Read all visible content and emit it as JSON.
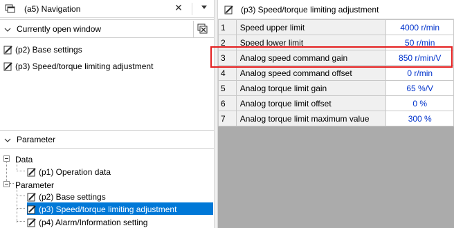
{
  "navigation": {
    "title": "(a5) Navigation",
    "close_glyph": "✕",
    "open_window_section": {
      "label": "Currently open window",
      "items": [
        {
          "label": "(p2) Base settings",
          "icon": "pencil-page-icon"
        },
        {
          "label": "(p3) Speed/torque limiting adjustment",
          "icon": "pencil-page-icon"
        }
      ]
    },
    "parameter_section": {
      "label": "Parameter",
      "tree": {
        "data_label": "Data",
        "data_children": [
          {
            "label": "(p1) Operation data"
          }
        ],
        "parameter_label": "Parameter",
        "parameter_children": [
          {
            "label": "(p2) Base settings",
            "selected": false
          },
          {
            "label": "(p3) Speed/torque limiting adjustment",
            "selected": true
          },
          {
            "label": "(p4) Alarm/Information setting",
            "selected": false
          }
        ]
      }
    }
  },
  "window": {
    "title": "(p3) Speed/torque limiting adjustment"
  },
  "table": {
    "rows": [
      {
        "no": "1",
        "name": "Speed upper limit",
        "value": "4000 r/min"
      },
      {
        "no": "2",
        "name": "Speed lower limit",
        "value": "50 r/min"
      },
      {
        "no": "3",
        "name": "Analog speed command gain",
        "value": "850 r/min/V"
      },
      {
        "no": "4",
        "name": "Analog speed command offset",
        "value": "0 r/min"
      },
      {
        "no": "5",
        "name": "Analog torque limit gain",
        "value": "65 %/V"
      },
      {
        "no": "6",
        "name": "Analog torque limit offset",
        "value": "0 %"
      },
      {
        "no": "7",
        "name": "Analog torque limit maximum value",
        "value": "300 %"
      }
    ]
  },
  "colors": {
    "selection": "#0078d7",
    "value_text": "#0033cc",
    "highlight": "#e41f1f",
    "workspace_bg": "#ababab"
  }
}
